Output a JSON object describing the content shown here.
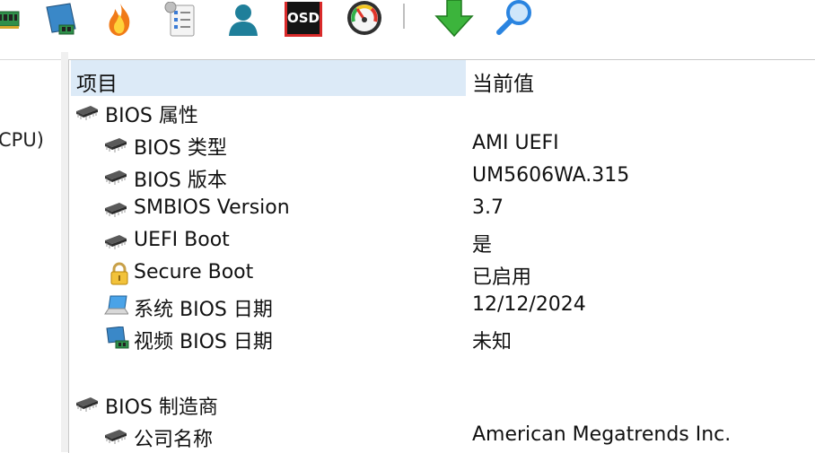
{
  "toolbar": {
    "buttons": [
      {
        "icon": "memory-module-icon"
      },
      {
        "icon": "network-card-icon"
      },
      {
        "icon": "flame-icon"
      },
      {
        "icon": "checklist-icon"
      },
      {
        "icon": "user-icon"
      },
      {
        "icon": "osd-icon",
        "label": "OSD"
      },
      {
        "icon": "speedometer-icon"
      },
      {
        "icon": "download-arrow-icon"
      },
      {
        "icon": "search-icon"
      }
    ]
  },
  "left_pane": {
    "partial_text": "CPU)"
  },
  "list": {
    "headers": {
      "item": "项目",
      "value": "当前值"
    },
    "rows": [
      {
        "label": "BIOS 属性",
        "value": "",
        "icon": "chip-icon"
      },
      {
        "label": "BIOS 类型",
        "value": "AMI UEFI",
        "icon": "chip-icon"
      },
      {
        "label": "BIOS 版本",
        "value": "UM5606WA.315",
        "icon": "chip-icon"
      },
      {
        "label": "SMBIOS Version",
        "value": "3.7",
        "icon": "chip-icon"
      },
      {
        "label": "UEFI Boot",
        "value": "是",
        "icon": "chip-icon"
      },
      {
        "label": "Secure Boot",
        "value": "已启用",
        "icon": "lock-icon"
      },
      {
        "label": "系统 BIOS 日期",
        "value": "12/12/2024",
        "icon": "laptop-icon"
      },
      {
        "label": "视频 BIOS 日期",
        "value": "未知",
        "icon": "monitor-icon"
      },
      {
        "label": "BIOS 制造商",
        "value": "",
        "icon": "chip-icon"
      },
      {
        "label": "公司名称",
        "value": "American Megatrends Inc.",
        "icon": "chip-icon"
      }
    ]
  },
  "colors": {
    "header_highlight": "#dceaf7",
    "accent_green": "#3cb43c",
    "accent_blue": "#2a84e0"
  }
}
